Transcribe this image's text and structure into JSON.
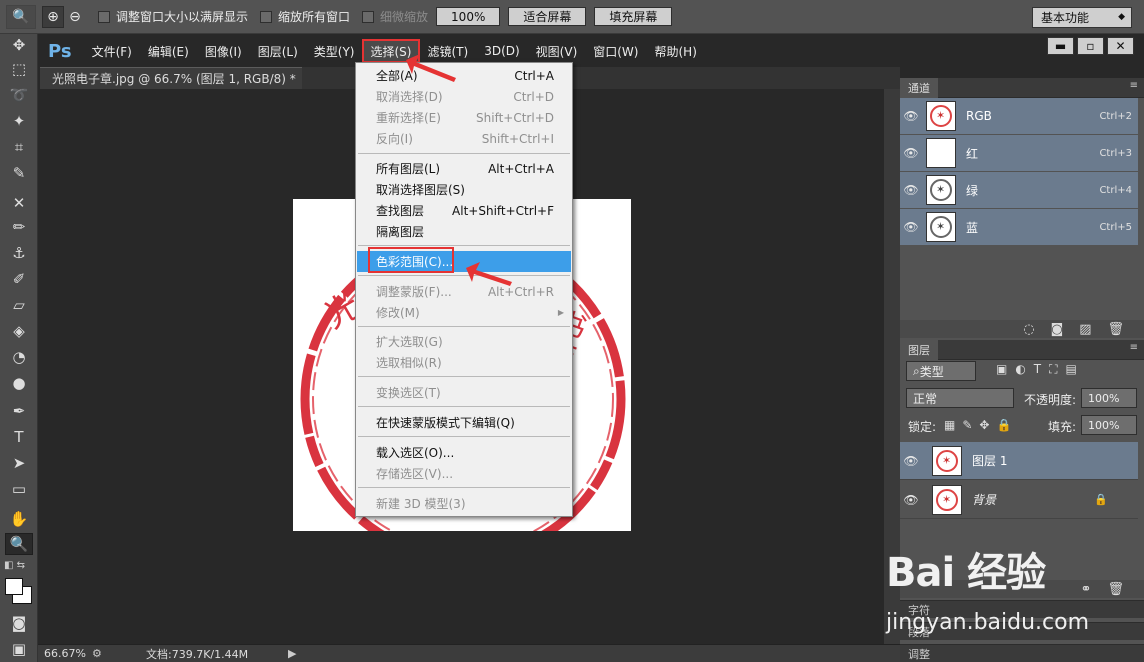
{
  "options_bar": {
    "resize_windows_label": "调整窗口大小以满屏显示",
    "zoom_all_windows_label": "缩放所有窗口",
    "scrubby_zoom_label": "细微缩放",
    "zoom_100_label": "100%",
    "fit_screen_label": "适合屏幕",
    "fill_screen_label": "填充屏幕",
    "workspace_label": "基本功能"
  },
  "menu_bar": {
    "logo": "Ps",
    "items": [
      "文件(F)",
      "编辑(E)",
      "图像(I)",
      "图层(L)",
      "类型(Y)",
      "选择(S)",
      "滤镜(T)",
      "3D(D)",
      "视图(V)",
      "窗口(W)",
      "帮助(H)"
    ]
  },
  "document": {
    "tab_title": "光照电子章.jpg @ 66.7% (图层 1, RGB/8) *",
    "close": "×",
    "seal_left_char": "光",
    "seal_right_chars": "书店店"
  },
  "select_menu": {
    "items": [
      {
        "label": "全部(A)",
        "shortcut": "Ctrl+A",
        "disabled": false
      },
      {
        "label": "取消选择(D)",
        "shortcut": "Ctrl+D",
        "disabled": true
      },
      {
        "label": "重新选择(E)",
        "shortcut": "Shift+Ctrl+D",
        "disabled": true
      },
      {
        "label": "反向(I)",
        "shortcut": "Shift+Ctrl+I",
        "disabled": true
      },
      {
        "label": "所有图层(L)",
        "shortcut": "Alt+Ctrl+A",
        "disabled": false
      },
      {
        "label": "取消选择图层(S)",
        "shortcut": "",
        "disabled": false
      },
      {
        "label": "查找图层",
        "shortcut": "Alt+Shift+Ctrl+F",
        "disabled": false
      },
      {
        "label": "隔离图层",
        "shortcut": "",
        "disabled": false
      },
      {
        "label": "色彩范围(C)...",
        "shortcut": "",
        "disabled": false
      },
      {
        "label": "调整蒙版(F)...",
        "shortcut": "Alt+Ctrl+R",
        "disabled": true
      },
      {
        "label": "修改(M)",
        "shortcut": "",
        "disabled": true
      },
      {
        "label": "扩大选取(G)",
        "shortcut": "",
        "disabled": true
      },
      {
        "label": "选取相似(R)",
        "shortcut": "",
        "disabled": true
      },
      {
        "label": "变换选区(T)",
        "shortcut": "",
        "disabled": true
      },
      {
        "label": "在快速蒙版模式下编辑(Q)",
        "shortcut": "",
        "disabled": false
      },
      {
        "label": "载入选区(O)...",
        "shortcut": "",
        "disabled": false
      },
      {
        "label": "存储选区(V)...",
        "shortcut": "",
        "disabled": true
      },
      {
        "label": "新建 3D 模型(3)",
        "shortcut": "",
        "disabled": true
      }
    ],
    "highlighted_index": 8,
    "submenu_arrow": "▶"
  },
  "channels_panel": {
    "tab": "通道",
    "rows": [
      {
        "name": "RGB",
        "shortcut": "Ctrl+2"
      },
      {
        "name": "红",
        "shortcut": "Ctrl+3"
      },
      {
        "name": "绿",
        "shortcut": "Ctrl+4"
      },
      {
        "name": "蓝",
        "shortcut": "Ctrl+5"
      }
    ]
  },
  "layers_panel": {
    "tab": "图层",
    "filter_label": "类型",
    "blend_mode": "正常",
    "opacity_label": "不透明度:",
    "opacity_value": "100%",
    "lock_label": "锁定:",
    "fill_label": "填充:",
    "fill_value": "100%",
    "layers": [
      {
        "name": "图层 1",
        "selected": true
      },
      {
        "name": "背景",
        "selected": false
      }
    ]
  },
  "collapsed_panels": {
    "character": "字符",
    "paragraph": "段落",
    "adjustments": "调整"
  },
  "status_bar": {
    "zoom": "66.67%",
    "doc_size": "文档:739.7K/1.44M"
  },
  "watermark": {
    "line1": "Bai 经验",
    "line2": "jingyan.baidu.com"
  },
  "colors": {
    "accent_red": "#e53333",
    "menu_highlight": "#3d9ee9",
    "selected_row": "#6b7b8e",
    "seal_red": "#d9343f"
  }
}
